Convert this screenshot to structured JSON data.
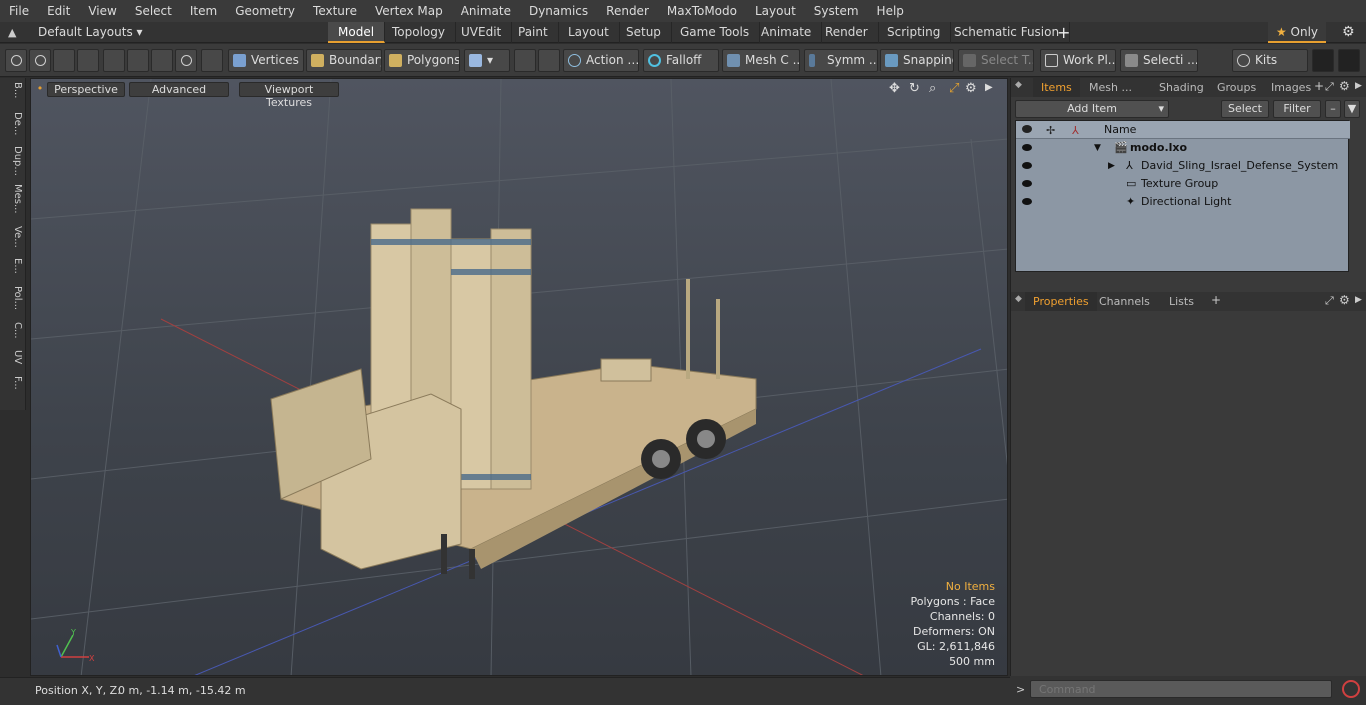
{
  "menu": [
    "File",
    "Edit",
    "View",
    "Select",
    "Item",
    "Geometry",
    "Texture",
    "Vertex Map",
    "Animate",
    "Dynamics",
    "Render",
    "MaxToModo",
    "Layout",
    "System",
    "Help"
  ],
  "layout_selector": "Default Layouts",
  "tabs": [
    "Model",
    "Topology",
    "UVEdit",
    "Paint",
    "Layout",
    "Setup",
    "Game Tools",
    "Animate",
    "Render",
    "Scripting",
    "Schematic Fusion"
  ],
  "active_tab": "Model",
  "only_label": "Only",
  "toolbar": {
    "vertices": "Vertices",
    "boundary": "Boundary",
    "polygons": "Polygons",
    "action": "Action",
    "falloff": "Falloff",
    "mesh_c": "Mesh C ...",
    "symm": "Symm ...",
    "snapping": "Snapping",
    "select_t": "Select T...",
    "work_pl": "Work Pl...",
    "selecti": "Selecti ...",
    "kits": "Kits"
  },
  "left_tabs": [
    "B...",
    "De...",
    "Dup...",
    "Mes...",
    "Ve...",
    "E...",
    "Pol...",
    "C...",
    "UV",
    "F..."
  ],
  "viewport": {
    "perspective": "Perspective",
    "advanced": "Advanced",
    "textures": "Viewport Textures",
    "hud": {
      "no_items": "No Items",
      "polygons": "Polygons : Face",
      "channels": "Channels: 0",
      "deformers": "Deformers: ON",
      "gl": "GL: 2,611,846",
      "scale": "500 mm"
    },
    "axis_x": "X",
    "axis_y": "Y"
  },
  "status": {
    "label": "Position X, Y, Z:",
    "value": "0 m, -1.14 m, -15.42 m"
  },
  "items_panel": {
    "tabs": [
      "Items",
      "Mesh ...",
      "Shading",
      "Groups",
      "Images"
    ],
    "add_item": "Add Item",
    "select": "Select",
    "filter": "Filter",
    "column": "Name",
    "rows": [
      {
        "name": "modo.lxo"
      },
      {
        "name": "David_Sling_Israel_Defense_System"
      },
      {
        "name": "Texture Group"
      },
      {
        "name": "Directional Light"
      }
    ]
  },
  "properties_panel": {
    "tabs": [
      "Properties",
      "Channels",
      "Lists"
    ]
  },
  "command_placeholder": "Command",
  "colors": {
    "accent": "#f0a030",
    "model": "#d8c8a4"
  }
}
